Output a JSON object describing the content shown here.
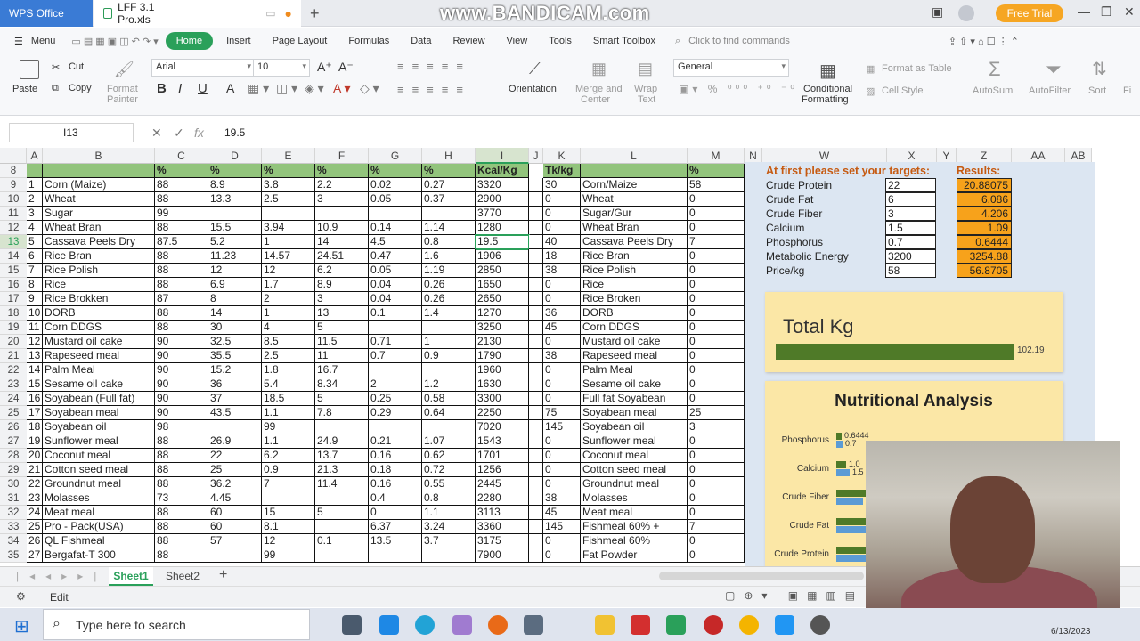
{
  "titlebar": {
    "app_tab": "WPS Office",
    "file_tab": "LFF 3.1 Pro.xls",
    "watermark": "www.BANDICAM.com",
    "free_trial": "Free Trial"
  },
  "menu": {
    "menu_label": "Menu",
    "tabs": [
      "Home",
      "Insert",
      "Page Layout",
      "Formulas",
      "Data",
      "Review",
      "View",
      "Tools",
      "Smart Toolbox"
    ],
    "search_placeholder": "Click to find commands"
  },
  "ribbon": {
    "paste": "Paste",
    "cut": "Cut",
    "copy": "Copy",
    "format_painter_1": "Format",
    "format_painter_2": "Painter",
    "font": "Arial",
    "font_size": "10",
    "orientation": "Orientation",
    "merge_1": "Merge and",
    "merge_2": "Center",
    "wrap_1": "Wrap",
    "wrap_2": "Text",
    "number_format": "General",
    "cond_1": "Conditional",
    "cond_2": "Formatting",
    "format_table": "Format as Table",
    "cell_style": "Cell Style",
    "autosum": "AutoSum",
    "autofilter": "AutoFilter",
    "sort": "Sort",
    "fi": "Fi"
  },
  "formula": {
    "cell_ref": "I13",
    "value": "19.5"
  },
  "columns": [
    "A",
    "B",
    "C",
    "D",
    "E",
    "F",
    "G",
    "H",
    "I",
    "J",
    "K",
    "L",
    "M",
    "N",
    "W",
    "X",
    "Y",
    "Z",
    "AA",
    "AB"
  ],
  "header_row": {
    "num": "8",
    "cols": [
      "",
      "",
      "%",
      "%",
      "%",
      "%",
      "%",
      "%",
      "Kcal/Kg",
      "",
      "Tk/kg",
      "",
      "%"
    ]
  },
  "rows": [
    [
      "9",
      "1",
      "Corn (Maize)",
      "88",
      "8.9",
      "3.8",
      "2.2",
      "0.02",
      "0.27",
      "3320",
      "30",
      "Corn/Maize",
      "58"
    ],
    [
      "10",
      "2",
      "Wheat",
      "88",
      "13.3",
      "2.5",
      "3",
      "0.05",
      "0.37",
      "2900",
      "0",
      "Wheat",
      "0"
    ],
    [
      "11",
      "3",
      "Sugar",
      "99",
      "",
      "",
      "",
      "",
      "",
      "3770",
      "0",
      "Sugar/Gur",
      "0"
    ],
    [
      "12",
      "4",
      "Wheat Bran",
      "88",
      "15.5",
      "3.94",
      "10.9",
      "0.14",
      "1.14",
      "1280",
      "0",
      "Wheat Bran",
      "0"
    ],
    [
      "13",
      "5",
      "Cassava Peels Dry",
      "87.5",
      "5.2",
      "1",
      "14",
      "4.5",
      "0.8",
      "19.5",
      "40",
      "Cassava Peels Dry",
      "7"
    ],
    [
      "14",
      "6",
      "Rice Bran",
      "88",
      "11.23",
      "14.57",
      "24.51",
      "0.47",
      "1.6",
      "1906",
      "18",
      "Rice Bran",
      "0"
    ],
    [
      "15",
      "7",
      "Rice Polish",
      "88",
      "12",
      "12",
      "6.2",
      "0.05",
      "1.19",
      "2850",
      "38",
      "Rice Polish",
      "0"
    ],
    [
      "16",
      "8",
      "Rice",
      "88",
      "6.9",
      "1.7",
      "8.9",
      "0.04",
      "0.26",
      "1650",
      "0",
      "Rice",
      "0"
    ],
    [
      "17",
      "9",
      "Rice Brokken",
      "87",
      "8",
      "2",
      "3",
      "0.04",
      "0.26",
      "2650",
      "0",
      "Rice Broken",
      "0"
    ],
    [
      "18",
      "10",
      "DORB",
      "88",
      "14",
      "1",
      "13",
      "0.1",
      "1.4",
      "1270",
      "36",
      "DORB",
      "0"
    ],
    [
      "19",
      "11",
      "Corn DDGS",
      "88",
      "30",
      "4",
      "5",
      "",
      "",
      "3250",
      "45",
      "Corn DDGS",
      "0"
    ],
    [
      "20",
      "12",
      "Mustard oil cake",
      "90",
      "32.5",
      "8.5",
      "11.5",
      "0.71",
      "1",
      "2130",
      "0",
      "Mustard oil cake",
      "0"
    ],
    [
      "21",
      "13",
      "Rapeseed meal",
      "90",
      "35.5",
      "2.5",
      "11",
      "0.7",
      "0.9",
      "1790",
      "38",
      "Rapeseed meal",
      "0"
    ],
    [
      "22",
      "14",
      "Palm Meal",
      "90",
      "15.2",
      "1.8",
      "16.7",
      "",
      "",
      "1960",
      "0",
      "Palm Meal",
      "0"
    ],
    [
      "23",
      "15",
      "Sesame oil cake",
      "90",
      "36",
      "5.4",
      "8.34",
      "2",
      "1.2",
      "1630",
      "0",
      "Sesame oil cake",
      "0"
    ],
    [
      "24",
      "16",
      "Soyabean (Full fat)",
      "90",
      "37",
      "18.5",
      "5",
      "0.25",
      "0.58",
      "3300",
      "0",
      "Full fat Soyabean",
      "0"
    ],
    [
      "25",
      "17",
      "Soyabean meal",
      "90",
      "43.5",
      "1.1",
      "7.8",
      "0.29",
      "0.64",
      "2250",
      "75",
      "Soyabean meal",
      "25"
    ],
    [
      "26",
      "18",
      "Soyabean oil",
      "98",
      "",
      "99",
      "",
      "",
      "",
      "7020",
      "145",
      "Soyabean oil",
      "3"
    ],
    [
      "27",
      "19",
      "Sunflower meal",
      "88",
      "26.9",
      "1.1",
      "24.9",
      "0.21",
      "1.07",
      "1543",
      "0",
      "Sunflower meal",
      "0"
    ],
    [
      "28",
      "20",
      "Coconut meal",
      "88",
      "22",
      "6.2",
      "13.7",
      "0.16",
      "0.62",
      "1701",
      "0",
      "Coconut meal",
      "0"
    ],
    [
      "29",
      "21",
      "Cotton seed meal",
      "88",
      "25",
      "0.9",
      "21.3",
      "0.18",
      "0.72",
      "1256",
      "0",
      "Cotton seed meal",
      "0"
    ],
    [
      "30",
      "22",
      "Groundnut meal",
      "88",
      "36.2",
      "7",
      "11.4",
      "0.16",
      "0.55",
      "2445",
      "0",
      "Groundnut meal",
      "0"
    ],
    [
      "31",
      "23",
      "Molasses",
      "73",
      "4.45",
      "",
      "",
      "0.4",
      "0.8",
      "2280",
      "38",
      "Molasses",
      "0"
    ],
    [
      "32",
      "24",
      "Meat meal",
      "88",
      "60",
      "15",
      "5",
      "0",
      "1.1",
      "3113",
      "45",
      "Meat meal",
      "0"
    ],
    [
      "33",
      "25",
      "Pro - Pack(USA)",
      "88",
      "60",
      "8.1",
      "",
      "6.37",
      "3.24",
      "3360",
      "145",
      "Fishmeal 60% +",
      "7"
    ],
    [
      "34",
      "26",
      "QL Fishmeal",
      "88",
      "57",
      "12",
      "0.1",
      "13.5",
      "3.7",
      "3175",
      "0",
      "Fishmeal 60%",
      "0"
    ],
    [
      "35",
      "27",
      "Bergafat-T 300",
      "88",
      "",
      "99",
      "",
      "",
      "",
      "7900",
      "0",
      "Fat Powder",
      "0"
    ]
  ],
  "targets": {
    "heading": "At first please set your targets:",
    "results_heading": "Results:",
    "items": [
      {
        "label": "Crude Protein",
        "target": "22",
        "result": "20.88075"
      },
      {
        "label": "Crude Fat",
        "target": "6",
        "result": "6.086"
      },
      {
        "label": "Crude Fiber",
        "target": "3",
        "result": "4.206"
      },
      {
        "label": "Calcium",
        "target": "1.5",
        "result": "1.09"
      },
      {
        "label": "Phosphorus",
        "target": "0.7",
        "result": "0.6444"
      },
      {
        "label": "Metabolic Energy",
        "target": "3200",
        "result": "3254.88"
      },
      {
        "label": "Price/kg",
        "target": "58",
        "result": "56.8705"
      }
    ]
  },
  "chart_data": [
    {
      "type": "bar",
      "title": "Total Kg",
      "values": [
        102.19
      ],
      "data_labels": [
        "102.19"
      ],
      "color": "#4f7a28"
    },
    {
      "type": "bar",
      "title": "Nutritional Analysis",
      "categories": [
        "Phosphorus",
        "Calcium",
        "Crude Fiber",
        "Crude Fat",
        "Crude Protein"
      ],
      "series": [
        {
          "values": [
            0.6444,
            1.09,
            4.206,
            6.086,
            20.88075
          ]
        },
        {
          "values": [
            0.7,
            1.5,
            3,
            6,
            22
          ]
        }
      ],
      "visible_labels": [
        "0.6444",
        "0.7",
        "1.0",
        "1.5"
      ],
      "category_labels": [
        "Phosphorus",
        "Calcium",
        "Crude Fiber",
        "Crude Fat",
        "Crude Protein"
      ]
    }
  ],
  "sheet_tabs": [
    "Sheet1",
    "Sheet2"
  ],
  "status": {
    "mode": "Edit"
  },
  "taskbar": {
    "search": "Type here to search",
    "date": "6/13/2023"
  },
  "colors": {
    "header_green": "#92c47c",
    "result_orange": "#f7a21b",
    "panel_blue": "#dce6f2",
    "chart_panel": "#fbe7a6",
    "bar_green": "#4f7a28",
    "bar_blue": "#5b9bd5",
    "wps_blue": "#3a7bd5",
    "home_green": "#2aa05a"
  }
}
